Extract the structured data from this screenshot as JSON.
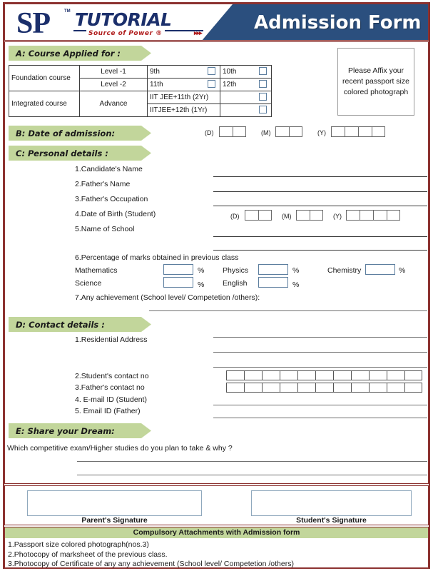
{
  "header": {
    "logo_main": "SP",
    "logo_tm": "TM",
    "logo_word": "TUTORIAL",
    "logo_tagline": "Source of Power ®",
    "logo_arrows": "▸▸▸",
    "title": "Admission Form",
    "colors": {
      "navy": "#2b4f7e",
      "maroon": "#8c3230",
      "red": "#b01c1c",
      "green": "#c2d69b"
    }
  },
  "photo_box": {
    "text": "Please Affix your recent passport size colored photograph"
  },
  "sections": {
    "a": {
      "banner": "A:  Course Applied for :"
    },
    "b": {
      "banner": "B:  Date of admission:"
    },
    "c": {
      "banner": "C:  Personal details :"
    },
    "d": {
      "banner": "D:  Contact details :"
    },
    "e": {
      "banner": "E:  Share your Dream:"
    }
  },
  "course_table": {
    "rows": [
      {
        "course": "Foundation course",
        "level": "Level -1",
        "opt1": "9th",
        "opt2": "10th"
      },
      {
        "course": "",
        "level": "Level -2",
        "opt1": "11th",
        "opt2": "12th"
      },
      {
        "course": "Integrated course",
        "level": "Advance",
        "opt1": "IIT JEE+11th (2Yr)",
        "opt2": ""
      },
      {
        "course": "",
        "level": "",
        "opt1": "IITJEE+12th (1Yr)",
        "opt2": ""
      }
    ]
  },
  "date_labels": {
    "day": "(D)",
    "month": "(M)",
    "year": "(Y)"
  },
  "personal": {
    "items": [
      "1.Candidate's Name",
      "2.Father's  Name",
      "3.Father's Occupation",
      "4.Date of Birth (Student)",
      "5.Name of School"
    ],
    "marks_heading": "6.Percentage of marks obtained in previous class",
    "subjects": [
      {
        "name": "Mathematics",
        "unit": "%"
      },
      {
        "name": "Physics",
        "unit": "%"
      },
      {
        "name": "Chemistry",
        "unit": "%"
      },
      {
        "name": "Science",
        "unit": "%"
      },
      {
        "name": "English",
        "unit": "%"
      }
    ],
    "achievement": "7.Any achievement (School level/ Competetion /others):"
  },
  "contact": {
    "items": [
      "1.Residential Address",
      "2.Student's  contact no",
      "3.Father's contact no",
      "4. E-mail ID (Student)",
      "5. Email ID (Father)"
    ],
    "phone_cells": 11
  },
  "dream": {
    "question": "Which competitive exam/Higher studies do you plan to take & why ?"
  },
  "signatures": {
    "parent": "Parent's Signature",
    "student": "Student's Signature"
  },
  "footer": {
    "heading": "Compulsory Attachments with Admission form",
    "items": [
      "1.Passport size colored photograph(nos.3)",
      "2.Photocopy of marksheet of the previous class.",
      "3.Photocopy of Certificate of any any achievement (School level/ Competetion /others)"
    ]
  }
}
